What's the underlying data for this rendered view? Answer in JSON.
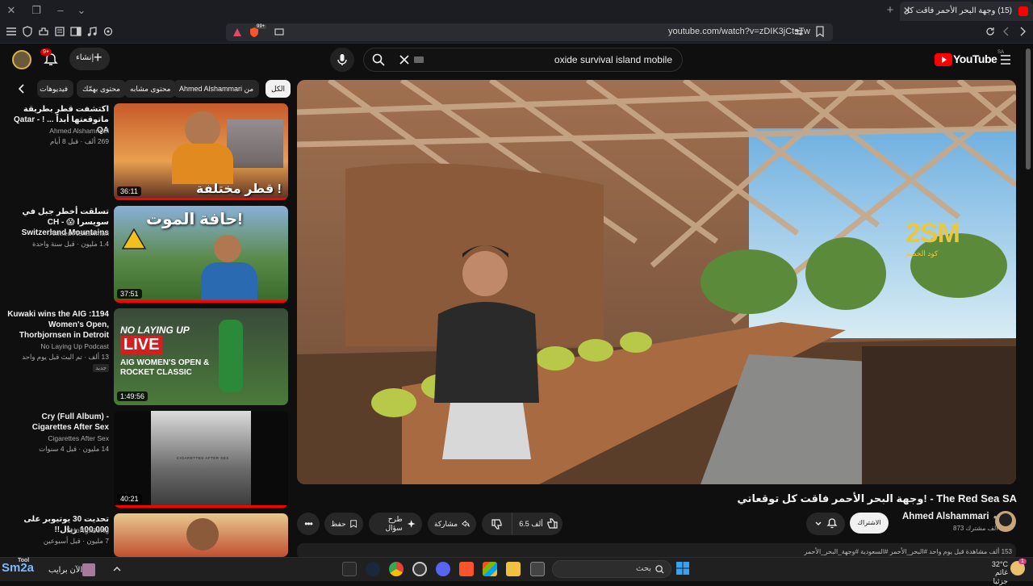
{
  "browser": {
    "tab_title": "(15) وجهة البحر الأحمر فاقت كل",
    "url": "youtube.com/watch?v=zDIK3jCtsTw",
    "brave_badge": "99+"
  },
  "header": {
    "search_query": "oxide survival island mobile",
    "create_label": "إنشاء",
    "notification_count": "9+",
    "logo_text": "YouTube",
    "logo_region": "SA"
  },
  "chips": [
    {
      "label": "الكل"
    },
    {
      "label": "من Ahmed Alshammari"
    },
    {
      "label": "محتوى مشابه"
    },
    {
      "label": "محتوى بهمّك"
    },
    {
      "label": "فيديوهات ..."
    }
  ],
  "sidebar": [
    {
      "title": "اكتشفت قطر بطريقة ماتوقعتها أبداً ... ! - Qatar QA",
      "thumb_text": "قطر مختلفة !",
      "channel": "Ahmed Alshammari",
      "meta": "269 ألف · قبل 8 أيام",
      "duration": "36:11",
      "progress": 1.0
    },
    {
      "title": "تسلقت أخطر جبل في سويسرا 😱 - CH Switzerland Mountains",
      "thumb_text": "حافة الموت!",
      "channel": "Ahmed Alshammari",
      "meta": "1.4 مليون · قبل سنة واحدة",
      "duration": "37:51",
      "progress": 1.0
    },
    {
      "title": "1194: Kuwaki wins the AIG Women's Open, Thorbjornsen in Detroit",
      "thumb_text_1": "NO LAYING UP",
      "thumb_text_2": "LIVE",
      "thumb_text_3": "AIG WOMEN'S OPEN & ROCKET CLASSIC",
      "channel": "No Laying Up Podcast",
      "meta": "13 ألف · تم البث قبل يوم واحد",
      "badge": "جديد",
      "duration": "1:49:56",
      "progress": 0
    },
    {
      "title": "Cry (Full Album) - Cigarettes After Sex",
      "thumb_text": "CIGARETTES AFTER SEX",
      "channel": "Cigarettes After Sex",
      "meta": "14 مليون · قبل 4 سنوات",
      "duration": "40:21",
      "progress": 1.0
    },
    {
      "title": "تحديت 30 يوتيوبر على 100,000 ريال!!",
      "channel": "SHoNgxBoNg",
      "meta": "7 مليون · قبل أسبوعين",
      "duration": "",
      "progress": 0
    }
  ],
  "video": {
    "title": "وجهة البحر الأحمر فاقت كل توقعاتي! - The Red Sea SA",
    "watermark": "2SM",
    "watermark_sub": "كود الخصم",
    "channel": "Ahmed Alshammari",
    "subscribers": "873 ألف مشترك",
    "subscribe_label": "الاشتراك",
    "likes": "6.5 ألف",
    "share_label": "مشاركة",
    "ask_label": "طرح سؤال",
    "save_label": "حفظ",
    "description": "153 ألف مشاهدة قبل يوم واحد  #البحر_الأحمر #السعودية #وجهة_البحر_الأحمر"
  },
  "taskbar": {
    "sm2a": "Sm2a",
    "sm2a_sub": "Tool",
    "user_label": "الآن برايب",
    "search_placeholder": "بحث",
    "temperature": "32°C",
    "weather": "غائم جزئيا",
    "notif_count": "1"
  },
  "colors": {
    "accent": "#ff0000",
    "bg": "#0f0f0f",
    "chip": "#272727"
  }
}
